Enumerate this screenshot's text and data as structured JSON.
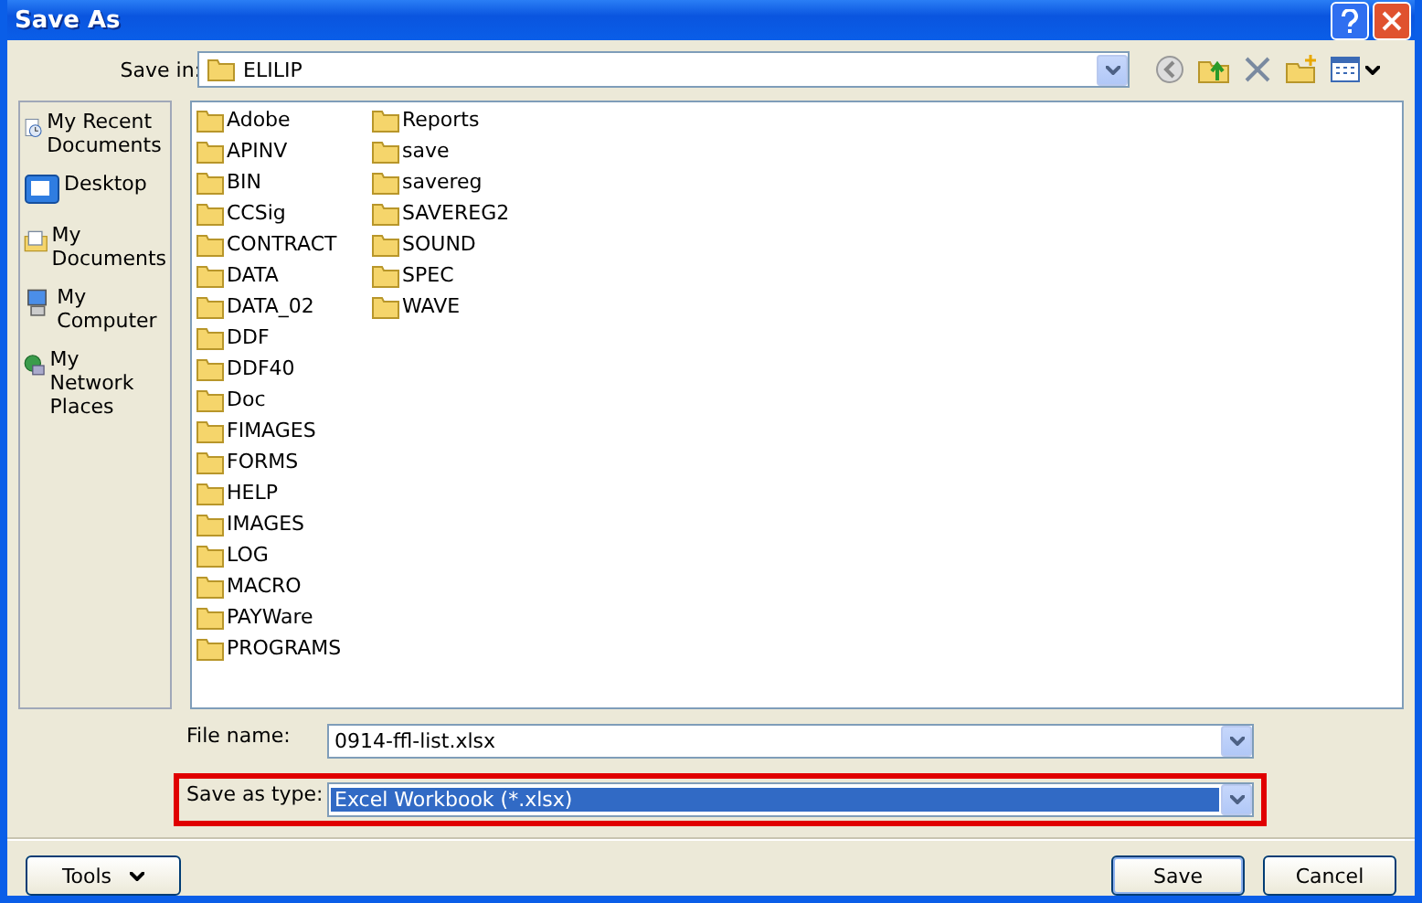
{
  "window": {
    "title": "Save As"
  },
  "save_in": {
    "label": "Save in:",
    "value": "ELILIP"
  },
  "places": [
    {
      "label": "My Recent Documents",
      "kind": "recent"
    },
    {
      "label": "Desktop",
      "kind": "desktop"
    },
    {
      "label": "My Documents",
      "kind": "documents"
    },
    {
      "label": "My Computer",
      "kind": "computer"
    },
    {
      "label": "My Network Places",
      "kind": "network"
    }
  ],
  "folders": [
    "Adobe",
    "APINV",
    "BIN",
    "CCSig",
    "CONTRACT",
    "DATA",
    "DATA_02",
    "DDF",
    "DDF40",
    "Doc",
    "FIMAGES",
    "FORMS",
    "HELP",
    "IMAGES",
    "LOG",
    "MACRO",
    "PAYWare",
    "PROGRAMS",
    "Reports",
    "save",
    "savereg",
    "SAVEREG2",
    "SOUND",
    "SPEC",
    "WAVE"
  ],
  "fields": [
    {
      "label": "File name:",
      "value": "0914-ffl-list.xlsx",
      "highlighted": false,
      "selected": false
    },
    {
      "label": "Save as type:",
      "value": "Excel Workbook (*.xlsx)",
      "highlighted": true,
      "selected": true
    }
  ],
  "buttons": [
    {
      "label": "Tools",
      "kind": "menu"
    },
    {
      "label": "Save",
      "kind": "default"
    },
    {
      "label": "Cancel",
      "kind": "plain"
    }
  ]
}
